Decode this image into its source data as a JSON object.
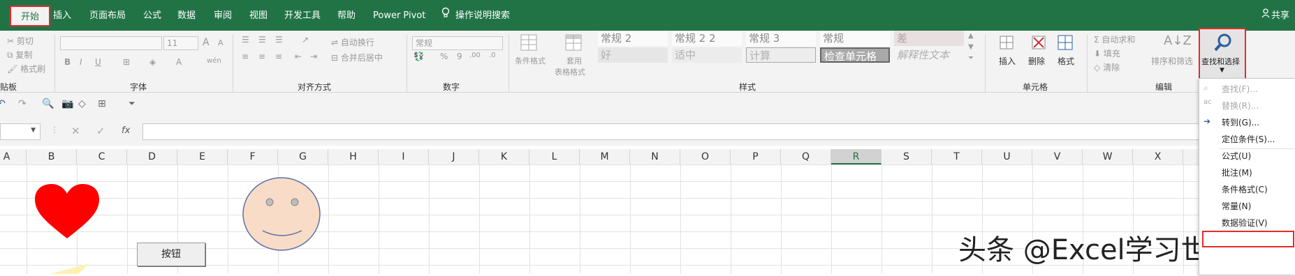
{
  "tabs": [
    {
      "label": "开始",
      "active": true
    },
    {
      "label": "插入"
    },
    {
      "label": "页面布局"
    },
    {
      "label": "公式"
    },
    {
      "label": "数据"
    },
    {
      "label": "审阅"
    },
    {
      "label": "视图"
    },
    {
      "label": "开发工具"
    },
    {
      "label": "帮助"
    },
    {
      "label": "Power Pivot"
    },
    {
      "label": "操作说明搜索"
    }
  ],
  "share_label": "共享",
  "clipboard": {
    "cut": "剪切",
    "copy": "复制",
    "format_painter": "格式刷",
    "group_label": "贴板"
  },
  "font": {
    "name_value": "",
    "size_value": "11",
    "group_label": "字体",
    "bold": "B",
    "italic": "I",
    "underline": "U",
    "grow": "A",
    "shrink": "A",
    "phonetic": "wén"
  },
  "alignment": {
    "wrap_text": "自动换行",
    "merge_center": "合并后居中",
    "group_label": "对齐方式"
  },
  "number": {
    "format_value": "常规",
    "percent": "%",
    "comma": "9",
    "group_label": "数字"
  },
  "styles": {
    "conditional_format": "条件格式",
    "format_as_table_1": "套用",
    "format_as_table_2": "表格格式",
    "group_label": "样式",
    "cells": [
      {
        "label": "常规 2",
        "row": 0
      },
      {
        "label": "常规 2 2",
        "row": 0
      },
      {
        "label": "常规 3",
        "row": 0
      },
      {
        "label": "常规",
        "row": 0
      },
      {
        "label": "差",
        "row": 0
      },
      {
        "label": "好",
        "row": 1
      },
      {
        "label": "适中",
        "row": 1
      },
      {
        "label": "计算",
        "row": 1
      },
      {
        "label": "检查单元格",
        "row": 1
      },
      {
        "label": "解释性文本",
        "row": 1
      }
    ]
  },
  "cells_group": {
    "insert": "插入",
    "delete": "删除",
    "format": "格式",
    "group_label": "单元格"
  },
  "editing": {
    "autosum": "自动求和",
    "fill": "填充",
    "clear": "清除",
    "sort_filter": "排序和筛选",
    "find_select": "查找和选择",
    "group_label": "编辑"
  },
  "formula_bar": {
    "fx": "fx",
    "cancel": "✕",
    "enter": "✓",
    "name_box": ""
  },
  "columns": [
    "A",
    "B",
    "C",
    "D",
    "E",
    "F",
    "G",
    "H",
    "I",
    "J",
    "K",
    "L",
    "M",
    "N",
    "O",
    "P",
    "Q",
    "R",
    "S",
    "T",
    "U",
    "V",
    "W",
    "X"
  ],
  "selected_column": "R",
  "dropdown_menu": [
    {
      "label": "查找(F)...",
      "disabled": true
    },
    {
      "label": "替换(R)...",
      "disabled": true
    },
    {
      "label": "转到(G)...",
      "disabled": false
    },
    {
      "label": "定位条件(S)...",
      "disabled": false
    },
    {
      "label": "公式(U)",
      "disabled": false
    },
    {
      "label": "批注(M)",
      "disabled": false
    },
    {
      "label": "条件格式(C)",
      "disabled": false
    },
    {
      "label": "常量(N)",
      "disabled": false
    },
    {
      "label": "数据验证(V)",
      "disabled": false
    }
  ],
  "sheet": {
    "button_label": "按钮"
  },
  "watermark": "头条 @Excel学习世界",
  "colors": {
    "accent": "#217346",
    "highlight": "#e32b2b",
    "heart": "#ff0000",
    "smiley_fill": "#f8dcc7",
    "smiley_stroke": "#5b6fa8"
  }
}
